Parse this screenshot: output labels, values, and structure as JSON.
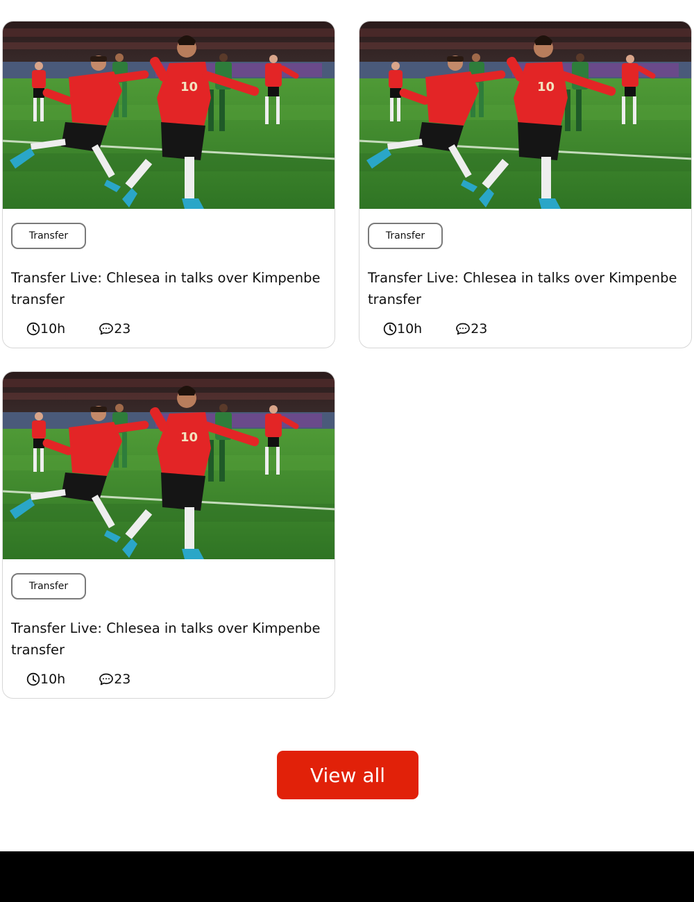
{
  "cards": [
    {
      "tag": "Transfer",
      "title": "Transfer Live: Chlesea in talks over Kimpenbe transfer",
      "time": "10h",
      "comments": "23"
    },
    {
      "tag": "Transfer",
      "title": "Transfer Live: Chlesea in talks over Kimpenbe transfer",
      "time": "10h",
      "comments": "23"
    },
    {
      "tag": "Transfer",
      "title": "Transfer Live: Chlesea in talks over Kimpenbe transfer",
      "time": "10h",
      "comments": "23"
    }
  ],
  "view_all_label": "View all",
  "icons": {
    "time": "clock-icon",
    "comments": "comment-icon"
  },
  "colors": {
    "accent": "#e12109",
    "footer": "#000000",
    "border": "#d6d6d6",
    "pitch": "#3e8a2c",
    "jersey": "#e32526"
  }
}
